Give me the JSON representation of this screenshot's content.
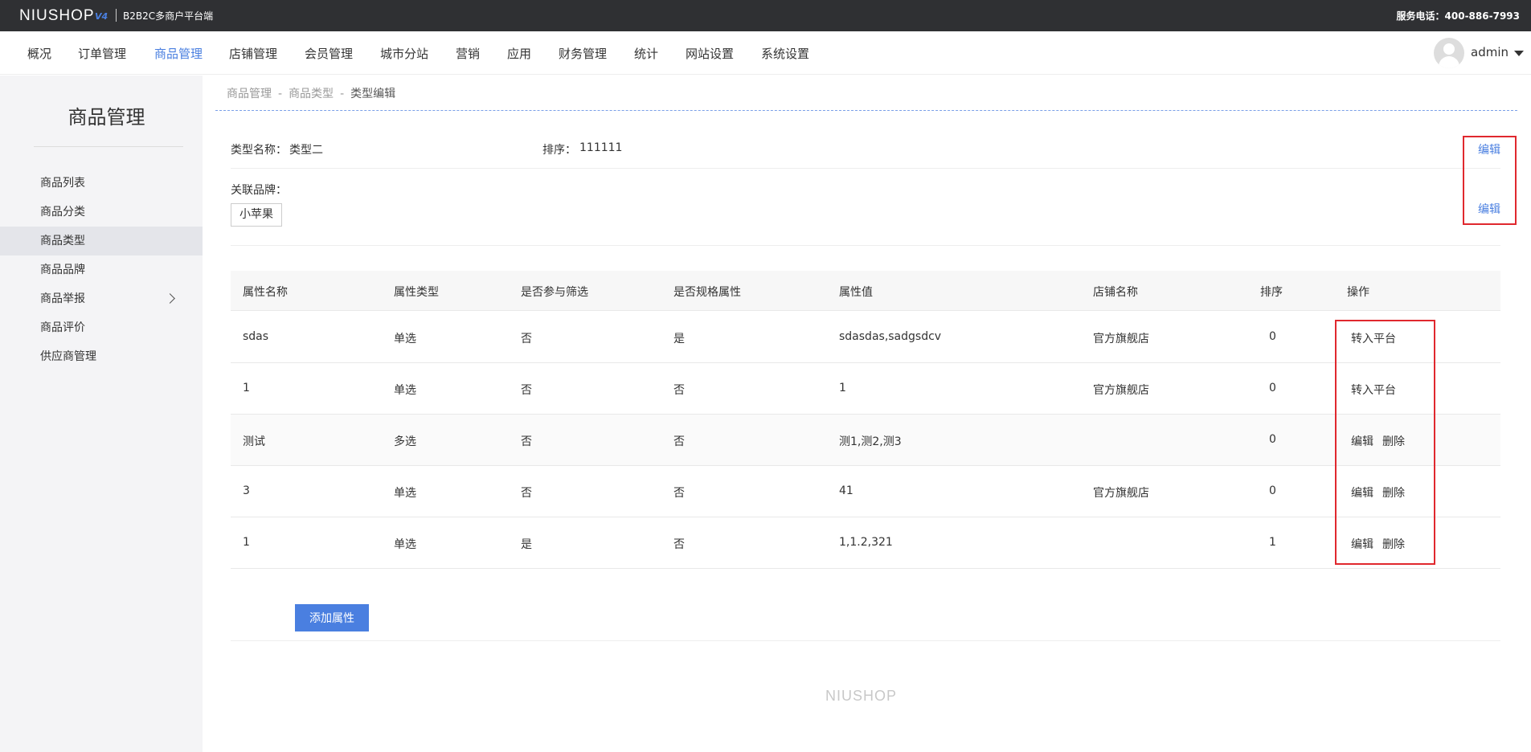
{
  "topbar": {
    "logo": "NIUSHOP",
    "logo_version": "V4",
    "subtitle": "B2B2C多商户平台端",
    "hotline": "服务电话：400-886-7993"
  },
  "mainnav": {
    "items": [
      "概况",
      "订单管理",
      "商品管理",
      "店铺管理",
      "会员管理",
      "城市分站",
      "营销",
      "应用",
      "财务管理",
      "统计",
      "网站设置",
      "系统设置"
    ],
    "active": "商品管理",
    "username": "admin"
  },
  "sidebar": {
    "title": "商品管理",
    "items": [
      "商品列表",
      "商品分类",
      "商品类型",
      "商品品牌",
      "商品举报",
      "商品评价",
      "供应商管理"
    ],
    "active": "商品类型"
  },
  "breadcrumb": {
    "items": [
      "商品管理",
      "商品类型",
      "类型编辑"
    ],
    "separator": "-"
  },
  "type_info": {
    "name_label": "类型名称：",
    "name_value": "类型二",
    "sort_label": "排序：",
    "sort_value": "111111",
    "edit_label": "编辑",
    "brand_label": "关联品牌：",
    "brand_tag": "小苹果",
    "brand_edit_label": "编辑"
  },
  "table": {
    "headers": [
      "属性名称",
      "属性类型",
      "是否参与筛选",
      "是否规格属性",
      "属性值",
      "店铺名称",
      "排序",
      "操作"
    ],
    "rows": [
      {
        "name": "sdas",
        "type": "单选",
        "filter": "否",
        "spec": "是",
        "values": "sdasdas,sadgsdcv",
        "shop": "官方旗舰店",
        "sort": "0",
        "actions": [
          "转入平台"
        ]
      },
      {
        "name": "1",
        "type": "单选",
        "filter": "否",
        "spec": "否",
        "values": "1",
        "shop": "官方旗舰店",
        "sort": "0",
        "actions": [
          "转入平台"
        ]
      },
      {
        "name": "测试",
        "type": "多选",
        "filter": "否",
        "spec": "否",
        "values": "测1,测2,测3",
        "shop": "",
        "sort": "0",
        "actions": [
          "编辑",
          "删除"
        ]
      },
      {
        "name": "3",
        "type": "单选",
        "filter": "否",
        "spec": "否",
        "values": "41",
        "shop": "官方旗舰店",
        "sort": "0",
        "actions": [
          "编辑",
          "删除"
        ]
      },
      {
        "name": "1",
        "type": "单选",
        "filter": "是",
        "spec": "否",
        "values": "1,1.2,321",
        "shop": "",
        "sort": "1",
        "actions": [
          "编辑",
          "删除"
        ]
      }
    ]
  },
  "add_button": "添加属性",
  "footer_logo": "NIUSHOP",
  "colors": {
    "topbar_bg": "#2f3033",
    "accent": "#4a7fe0",
    "highlight_box": "#e0282e",
    "sidebar_bg": "#f4f4f6"
  }
}
